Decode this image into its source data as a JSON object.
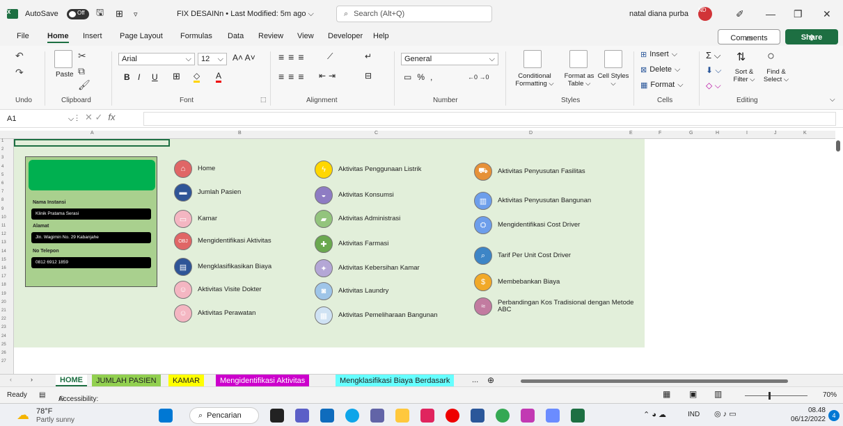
{
  "titlebar": {
    "autosave_label": "AutoSave",
    "autosave_state": "Off",
    "doc_title": "FIX DESAINn • Last Modified: 5m ago ⌵",
    "search_placeholder": "Search (Alt+Q)",
    "user_name": "natal diana purba",
    "user_initials": "ND"
  },
  "menu": {
    "tabs": [
      "File",
      "Home",
      "Insert",
      "Page Layout",
      "Formulas",
      "Data",
      "Review",
      "View",
      "Developer",
      "Help"
    ],
    "active": "Home",
    "comments_label": "Comments",
    "share_label": "Share"
  },
  "ribbon": {
    "undo_label": "Undo",
    "clipboard_label": "Clipboard",
    "paste_label": "Paste",
    "font_label": "Font",
    "font_name": "Arial",
    "font_size": "12",
    "alignment_label": "Alignment",
    "number_label": "Number",
    "number_format": "General",
    "styles_label": "Styles",
    "conditional_formatting": "Conditional Formatting ⌵",
    "format_as_table": "Format as Table ⌵",
    "cell_styles": "Cell Styles ⌵",
    "cells_label": "Cells",
    "insert_label": "Insert",
    "delete_label": "Delete",
    "format_label": "Format",
    "editing_label": "Editing",
    "sort_filter": "Sort & Filter ⌵",
    "find_select": "Find & Select ⌵"
  },
  "formula": {
    "cell_ref": "A1",
    "fx_label": "fx",
    "value": ""
  },
  "grid": {
    "columns": [
      "A",
      "B",
      "C",
      "D",
      "E",
      "F",
      "G",
      "H",
      "I",
      "J",
      "K"
    ],
    "rows": [
      "1",
      "2",
      "3",
      "4",
      "5",
      "6",
      "7",
      "8",
      "9",
      "10",
      "11",
      "12",
      "13",
      "14",
      "15",
      "16",
      "17",
      "18",
      "19",
      "20",
      "21",
      "22",
      "23",
      "24",
      "25",
      "26",
      "27"
    ]
  },
  "card": {
    "instansi_label": "Nama Instansi",
    "instansi_value": "Klinik Pratama Serasi",
    "alamat_label": "Alamat",
    "alamat_value": "Jln. Wagimin No. 29 Kabanjahe",
    "telepon_label": "No Telepon",
    "telepon_value": "0812 6912 1859"
  },
  "menu_items": {
    "col1": [
      {
        "label": "Home",
        "icon": "home-icon",
        "color": "#e06666"
      },
      {
        "label": "Jumlah Pasien",
        "icon": "bed-icon",
        "color": "#2f5597"
      },
      {
        "label": "Kamar",
        "icon": "room-icon",
        "color": "#f4b6c2"
      },
      {
        "label": "Mengidentifikasi Aktivitas",
        "icon": "obj-icon",
        "color": "#e06666"
      },
      {
        "label": "Mengklasifikasikan Biaya",
        "icon": "classify-icon",
        "color": "#2f5597"
      },
      {
        "label": "Aktivitas Visite Dokter",
        "icon": "doctor-icon",
        "color": "#f4b6c2"
      },
      {
        "label": "Aktivitas Perawatan",
        "icon": "nurse-icon",
        "color": "#f4b6c2"
      }
    ],
    "col2": [
      {
        "label": "Aktivitas Penggunaan Listrik",
        "icon": "lightning-icon",
        "color": "#ffd700"
      },
      {
        "label": "Aktivitas Konsumsi",
        "icon": "food-icon",
        "color": "#8e7cc3"
      },
      {
        "label": "Aktivitas Administrasi",
        "icon": "admin-icon",
        "color": "#93c47d"
      },
      {
        "label": "Aktivitas Farmasi",
        "icon": "pharmacy-icon",
        "color": "#6aa84f"
      },
      {
        "label": "Aktivitas Kebersihan Kamar",
        "icon": "cleaning-icon",
        "color": "#b4a7d6"
      },
      {
        "label": "Aktivitas Laundry",
        "icon": "laundry-icon",
        "color": "#9fc5e8"
      },
      {
        "label": "Aktivitas Pemeliharaan Bangunan",
        "icon": "building-icon",
        "color": "#cfe2f3"
      }
    ],
    "col3": [
      {
        "label": "Aktivitas Penyusutan Fasilitas",
        "icon": "facility-icon",
        "color": "#e69138"
      },
      {
        "label": "Aktivitas Penyusutan Bangunan",
        "icon": "office-icon",
        "color": "#6d9eeb"
      },
      {
        "label": "Mengidentifikasi Cost Driver",
        "icon": "cost-driver-icon",
        "color": "#6d9eeb"
      },
      {
        "label": "Tarif Per Unit Cost Driver",
        "icon": "magnifier-icon",
        "color": "#3d85c6"
      },
      {
        "label": "Membebankan Biaya",
        "icon": "dollar-icon",
        "color": "#f1a928"
      },
      {
        "label": "Perbandingan Kos Tradisional dengan Metode ABC",
        "icon": "approx-icon",
        "color": "#c27ba0"
      }
    ]
  },
  "sheets": [
    {
      "label": "HOME",
      "color": "#ffffff",
      "text": "#1d6f42"
    },
    {
      "label": "JUMLAH PASIEN",
      "color": "#92d050",
      "text": "#222"
    },
    {
      "label": "KAMAR",
      "color": "#ffff00",
      "text": "#222"
    },
    {
      "label": "Mengidentifikasi Aktivitas",
      "color": "#cc00cc",
      "text": "#fff"
    },
    {
      "label": "Mengklasifikasi Biaya Berdasark",
      "color": "#66ffff",
      "text": "#222"
    }
  ],
  "sheets_more": "...",
  "status": {
    "ready": "Ready",
    "accessibility": "Accessibility: Investigate",
    "zoom": "70%"
  },
  "taskbar": {
    "weather_temp": "78°F",
    "weather_desc": "Partly sunny",
    "search_label": "Pencarian",
    "lang": "IND",
    "time": "08.48",
    "date": "06/12/2022",
    "notif_count": "4"
  }
}
